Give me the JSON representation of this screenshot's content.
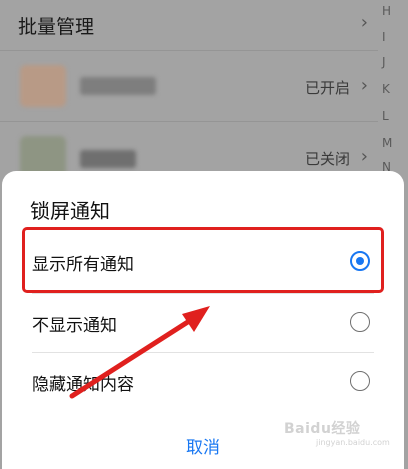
{
  "background_list": {
    "batch_label": "批量管理",
    "rows": [
      {
        "status": "已开启"
      },
      {
        "status": "已关闭"
      }
    ],
    "alphabet": [
      "H",
      "I",
      "J",
      "K",
      "L",
      "M",
      "N"
    ]
  },
  "dialog": {
    "title": "锁屏通知",
    "options": [
      {
        "label": "显示所有通知",
        "selected": true
      },
      {
        "label": "不显示通知",
        "selected": false
      },
      {
        "label": "隐藏通知内容",
        "selected": false
      }
    ],
    "cancel_label": "取消"
  },
  "colors": {
    "accent": "#1877f2",
    "highlight": "#e0201e"
  },
  "watermark": {
    "brand": "Baidu经验",
    "url": "jingyan.baidu.com"
  }
}
